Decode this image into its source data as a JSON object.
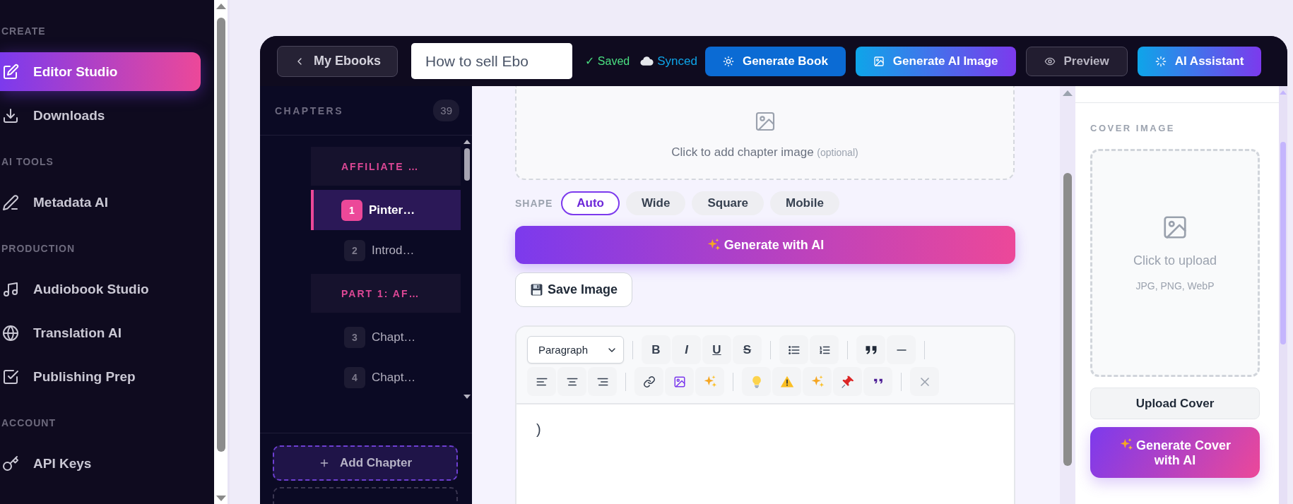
{
  "sidebar": {
    "sections": [
      {
        "heading": "CREATE",
        "items": [
          {
            "label": "Editor Studio",
            "selected": true
          },
          {
            "label": "Downloads",
            "selected": false
          }
        ]
      },
      {
        "heading": "AI TOOLS",
        "items": [
          {
            "label": "Metadata AI",
            "selected": false
          }
        ]
      },
      {
        "heading": "PRODUCTION",
        "items": [
          {
            "label": "Audiobook Studio",
            "selected": false
          },
          {
            "label": "Translation AI",
            "selected": false
          },
          {
            "label": "Publishing Prep",
            "selected": false
          }
        ]
      },
      {
        "heading": "ACCOUNT",
        "items": [
          {
            "label": "API Keys",
            "selected": false
          }
        ]
      }
    ]
  },
  "topbar": {
    "back_button": "My Ebooks",
    "title": "How to sell Ebo",
    "status": [
      {
        "kind": "saved",
        "text": "✓ Saved"
      },
      {
        "kind": "synced",
        "text": "Synced"
      }
    ],
    "buttons": [
      {
        "label": "Generate Book",
        "kind": "solid"
      },
      {
        "label": "Generate AI Image",
        "kind": "gradient"
      },
      {
        "label": "Preview",
        "kind": "dark"
      },
      {
        "label": "AI Assistant",
        "kind": "gradient"
      }
    ]
  },
  "chapters": {
    "title": "CHAPTERS",
    "count": "39",
    "parts": [
      {
        "title": "AFFILIATE …",
        "children": [
          {
            "number": "1",
            "title": "Pinter…",
            "selected": true
          },
          {
            "number": "2",
            "title": "Introd…",
            "selected": false
          }
        ]
      },
      {
        "title": "PART 1: AF…",
        "children": [
          {
            "number": "3",
            "title": "Chapt…",
            "selected": false
          },
          {
            "number": "4",
            "title": "Chapt…",
            "selected": false
          }
        ]
      }
    ],
    "buttons": [
      "Add Chapter"
    ]
  },
  "chapter_image": {
    "prompt": "Click to add chapter image",
    "hint": "(optional)",
    "shape_label": "SHAPE",
    "shapes": [
      {
        "label": "Auto",
        "selected": true
      },
      {
        "label": "Wide",
        "selected": false
      },
      {
        "label": "Square",
        "selected": false
      },
      {
        "label": "Mobile",
        "selected": false
      }
    ],
    "generate_button": "Generate with AI",
    "save_button": "Save Image"
  },
  "editor": {
    "block_format": "Paragraph",
    "format_buttons": [
      {
        "label": "B",
        "kind": "bold"
      },
      {
        "label": "I",
        "kind": "italic"
      },
      {
        "label": "U",
        "kind": "underline"
      },
      {
        "label": "S",
        "kind": "strike"
      }
    ],
    "content": ")"
  },
  "cover": {
    "heading": "COVER IMAGE",
    "prompt": "Click to upload",
    "formats": "JPG, PNG, WebP",
    "upload_button": "Upload Cover",
    "generate_button": "Generate Cover with AI"
  }
}
